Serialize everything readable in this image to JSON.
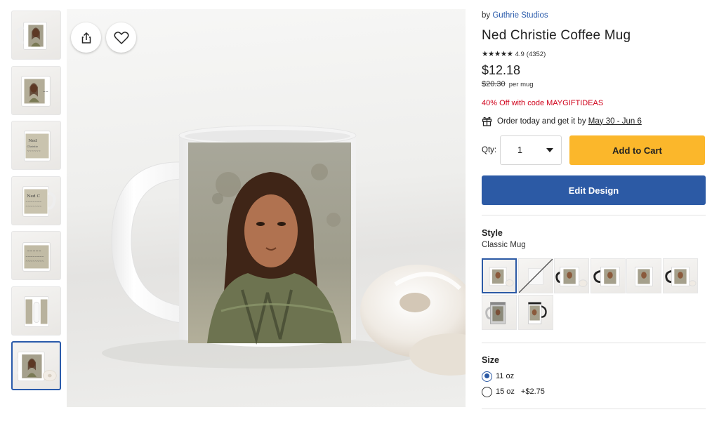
{
  "thumbnails": [
    {
      "alt": "Mug front view",
      "view": "front"
    },
    {
      "alt": "Mug side view",
      "view": "side"
    },
    {
      "alt": "Mug back text view",
      "view": "text"
    },
    {
      "alt": "Mug text close",
      "view": "text"
    },
    {
      "alt": "Mug handle text",
      "view": "text-handle"
    },
    {
      "alt": "Mug handle view",
      "view": "handle"
    },
    {
      "alt": "Mug with donut",
      "view": "front",
      "selected": true
    }
  ],
  "main_image": {
    "alt": "Ned Christie Coffee Mug with donut",
    "share_icon": "share-icon",
    "favorite_icon": "heart-icon"
  },
  "product": {
    "by_prefix": "by",
    "store": "Guthrie Studios",
    "title": "Ned Christie Coffee Mug",
    "stars": "★★★★★",
    "rating": "4.9",
    "reviews": "(4352)",
    "price": "$12.18",
    "original_price": "$20.30",
    "per_unit": "per mug",
    "promo": "40% Off with code MAYGIFTIDEAS",
    "delivery_prefix": "Order today and get it by",
    "delivery_dates": "May 30 - Jun 6",
    "gift_icon": "gift-icon"
  },
  "purchase": {
    "qty_label": "Qty:",
    "qty_value": "1",
    "add_to_cart": "Add to Cart",
    "edit_design": "Edit Design"
  },
  "style": {
    "label": "Style",
    "selected": "Classic Mug",
    "options": [
      {
        "name": "Classic Mug",
        "selected": true,
        "available": true
      },
      {
        "name": "Unavailable style",
        "selected": false,
        "available": false
      },
      {
        "name": "Two-Tone Mug Black",
        "selected": false,
        "available": true
      },
      {
        "name": "Two-Tone Mug Black Handle",
        "selected": false,
        "available": true
      },
      {
        "name": "Classic Mug Alt",
        "selected": false,
        "available": true
      },
      {
        "name": "Two-Tone Mug Alt",
        "selected": false,
        "available": true
      },
      {
        "name": "Travel Mug",
        "selected": false,
        "available": true
      },
      {
        "name": "Tumbler",
        "selected": false,
        "available": true
      }
    ]
  },
  "size": {
    "label": "Size",
    "options": [
      {
        "label": "11 oz",
        "upcharge": "",
        "checked": true
      },
      {
        "label": "15 oz",
        "upcharge": "+$2.75",
        "checked": false
      }
    ]
  },
  "colors": {
    "accent_blue": "#2c5aa5",
    "cart_yellow": "#fbb72b",
    "promo_red": "#d0021b",
    "link_blue": "#2a5bab"
  }
}
